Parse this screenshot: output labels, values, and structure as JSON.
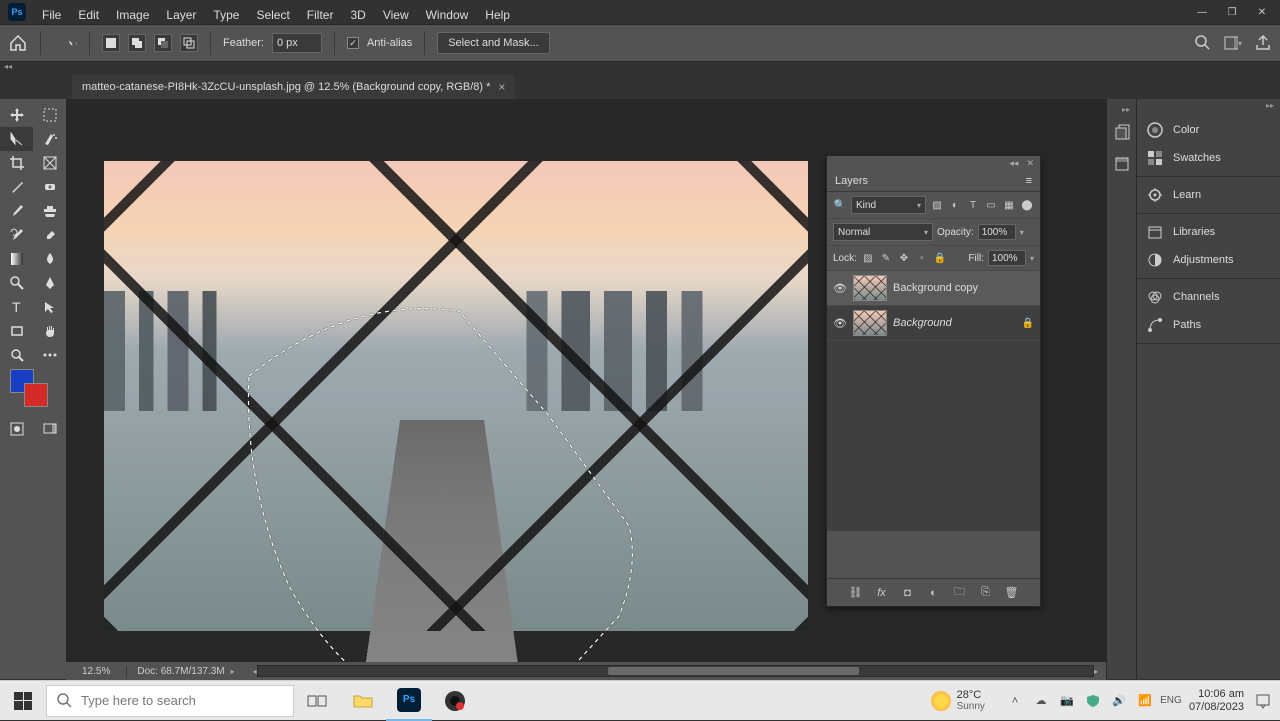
{
  "app": {
    "name": "Ps"
  },
  "menus": [
    "File",
    "Edit",
    "Image",
    "Layer",
    "Type",
    "Select",
    "Filter",
    "3D",
    "View",
    "Window",
    "Help"
  ],
  "options": {
    "feather_label": "Feather:",
    "feather_value": "0 px",
    "antialias_label": "Anti-alias",
    "antialias_checked": true,
    "select_mask_label": "Select and Mask..."
  },
  "document": {
    "tab_title": "matteo-catanese-PI8Hk-3ZcCU-unsplash.jpg @ 12.5% (Background copy, RGB/8) *"
  },
  "colors": {
    "foreground": "#1a3fc4",
    "background": "#d42a2a"
  },
  "layers_panel": {
    "title": "Layers",
    "filter_label": "Kind",
    "blend_mode": "Normal",
    "opacity_label": "Opacity:",
    "opacity_value": "100%",
    "lock_label": "Lock:",
    "fill_label": "Fill:",
    "fill_value": "100%",
    "items": [
      {
        "name": "Background copy",
        "visible": true,
        "locked": false,
        "italic": false,
        "selected": true
      },
      {
        "name": "Background",
        "visible": true,
        "locked": true,
        "italic": true,
        "selected": false
      }
    ]
  },
  "right_dock": {
    "groups": [
      [
        "Color",
        "Swatches"
      ],
      [
        "Learn"
      ],
      [
        "Libraries",
        "Adjustments"
      ],
      [
        "Channels",
        "Paths"
      ]
    ]
  },
  "status": {
    "zoom": "12.5%",
    "doc_info": "Doc: 68.7M/137.3M"
  },
  "taskbar": {
    "search_placeholder": "Type here to search",
    "weather_temp": "28°C",
    "weather_desc": "Sunny",
    "time": "10:06 am",
    "date": "07/08/2023"
  }
}
